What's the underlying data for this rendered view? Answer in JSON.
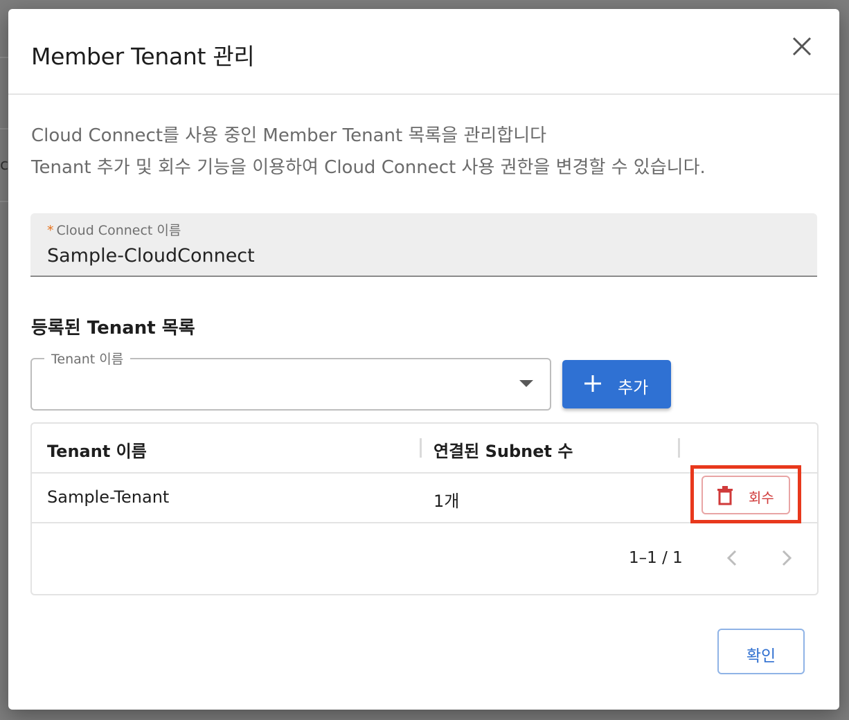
{
  "background": {
    "partial_char": "c"
  },
  "dialog": {
    "title": "Member Tenant 관리",
    "close_icon": "close-icon",
    "description_line1": "Cloud Connect를 사용 중인 Member Tenant 목록을 관리합니다",
    "description_line2": "Tenant 추가 및 회수 기능을 이용하여 Cloud Connect 사용 권한을 변경할 수 있습니다.",
    "cloud_connect_field": {
      "required_mark": "*",
      "label": "Cloud Connect 이름",
      "value": "Sample-CloudConnect"
    },
    "section_title": "등록된 Tenant 목록",
    "tenant_select": {
      "label": "Tenant 이름",
      "value": ""
    },
    "add_button": {
      "label": "추가",
      "icon": "plus-icon"
    },
    "table": {
      "headers": [
        "Tenant 이름",
        "연결된 Subnet 수",
        ""
      ],
      "rows": [
        {
          "tenant_name": "Sample-Tenant",
          "subnet_count": "1개",
          "action_label": "회수",
          "action_icon": "trash-icon"
        }
      ],
      "pagination": "1–1 / 1"
    },
    "confirm_button": "확인"
  },
  "colors": {
    "primary": "#2f71d3",
    "danger": "#d03a3a",
    "highlight": "#e8381c",
    "required": "#e6721c"
  }
}
